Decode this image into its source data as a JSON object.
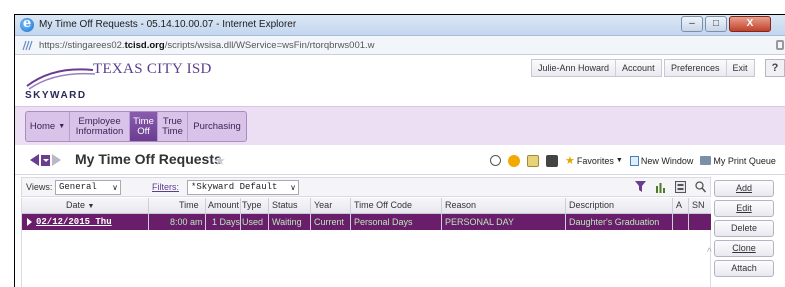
{
  "window": {
    "title": "My Time Off Requests - 05.14.10.00.07 - Internet Explorer",
    "url_prefix": "https://stingarees02.",
    "url_domain": "tcisd.org",
    "url_suffix": "/scripts/wsisa.dll/WService=wsFin/rtorqbrws001.w",
    "minimize": "–",
    "maximize": "□",
    "close": "X"
  },
  "header": {
    "district": "TEXAS CITY ISD",
    "logo_text": "SKYWARD",
    "user": "Julie-Ann Howard",
    "account": "Account",
    "preferences": "Preferences",
    "exit": "Exit",
    "help": "?"
  },
  "nav": {
    "tabs": [
      {
        "label": "Home"
      },
      {
        "label": "Employee Information"
      },
      {
        "label": "Time Off"
      },
      {
        "label": "True Time"
      },
      {
        "label": "Purchasing"
      }
    ]
  },
  "page": {
    "title": "My Time Off Requests",
    "favorites": "Favorites",
    "new_window": "New Window",
    "print_queue": "My Print Queue"
  },
  "gridbar": {
    "views_label": "Views:",
    "views_value": "General",
    "filters_label": "Filters:",
    "filters_value": "*Skyward Default"
  },
  "table": {
    "headers": {
      "date": "Date",
      "time": "Time",
      "amount": "Amount",
      "type": "Type",
      "status": "Status",
      "year": "Year",
      "code": "Time Off Code",
      "reason": "Reason",
      "description": "Description",
      "a": "A",
      "sn": "SN"
    },
    "rows": [
      {
        "date": "02/12/2015 Thu",
        "time": "8:00 am",
        "amount": "1 Days",
        "type": "Used",
        "status": "Waiting",
        "year": "Current",
        "code": "Personal Days",
        "reason": "PERSONAL DAY",
        "description": "Daughter's Graduation"
      }
    ]
  },
  "actions": {
    "add": "Add",
    "edit": "Edit",
    "delete": "Delete",
    "clone": "Clone",
    "attach": "Attach"
  },
  "colors": {
    "accent": "#6a3d91",
    "row_highlight": "#6a1d6b",
    "nav_background": "#ecdff3"
  }
}
